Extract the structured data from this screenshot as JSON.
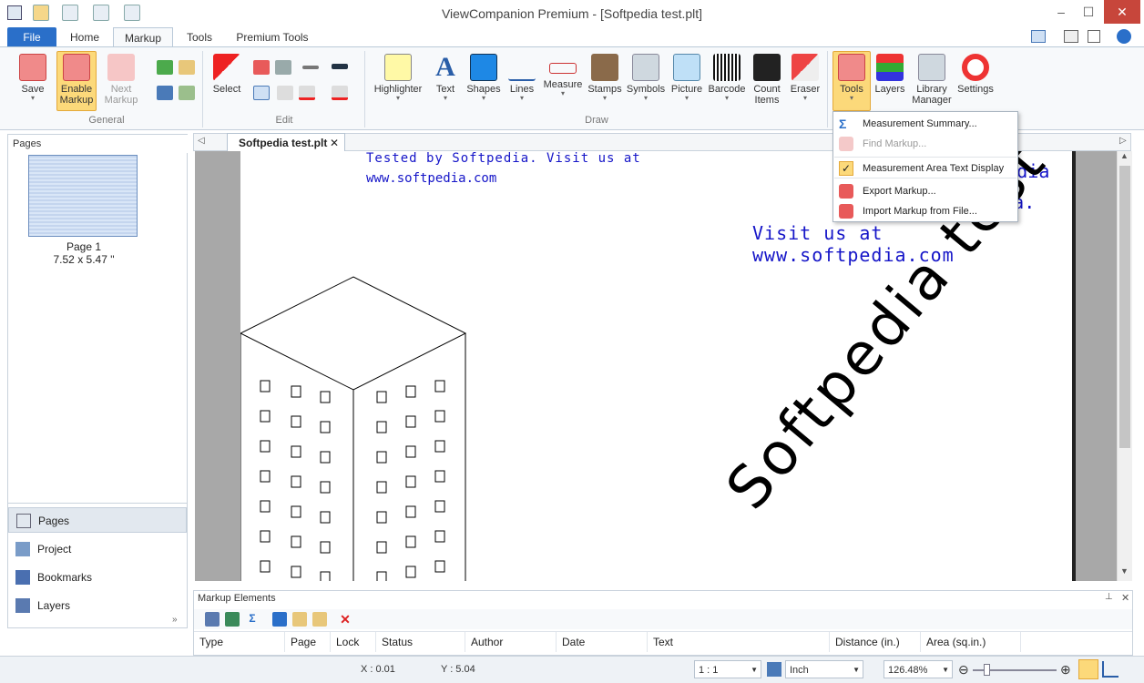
{
  "window": {
    "title": "ViewCompanion Premium - [Softpedia test.plt]",
    "minimize": "–",
    "maximize": "☐",
    "close": "✕"
  },
  "tabs": {
    "file": "File",
    "home": "Home",
    "markup": "Markup",
    "tools": "Tools",
    "premium": "Premium Tools"
  },
  "ribbon": {
    "general": {
      "label": "General",
      "save": "Save",
      "enable1": "Enable",
      "enable2": "Markup",
      "next1": "Next",
      "next2": "Markup"
    },
    "edit": {
      "label": "Edit",
      "select": "Select"
    },
    "draw": {
      "label": "Draw",
      "highlighter": "Highlighter",
      "text": "Text",
      "shapes": "Shapes",
      "lines": "Lines",
      "measure": "Measure",
      "stamps": "Stamps",
      "symbols": "Symbols",
      "picture": "Picture",
      "barcode": "Barcode",
      "count1": "Count",
      "count2": "Items",
      "eraser": "Eraser"
    },
    "right": {
      "tools": "Tools",
      "layers": "Layers",
      "library1": "Library",
      "library2": "Manager",
      "settings": "Settings"
    }
  },
  "tools_menu": {
    "items": [
      "Measurement Summary...",
      "Find Markup...",
      "Measurement  Area Text Display",
      "Export Markup...",
      "Import Markup from File..."
    ]
  },
  "left": {
    "pages_header": "Pages",
    "page_label": "Page 1",
    "page_size": "7.52 x 5.47 \"",
    "nav": [
      "Pages",
      "Project",
      "Bookmarks",
      "Layers"
    ]
  },
  "doc": {
    "tab": "Softpedia test.plt",
    "line1": "Tested  by Softpedia.   Visit   us at",
    "line2": "www.softpedia.com",
    "right1": "Softpedia",
    "right2": "pedia.",
    "right3": "Visit  us  at  www.softpedia.com",
    "diag": "Softpedia test"
  },
  "markup_panel": {
    "title": "Markup Elements",
    "columns": [
      "Type",
      "Page",
      "Lock",
      "Status",
      "Author",
      "Date",
      "Text",
      "Distance (in.)",
      "Area (sq.in.)"
    ]
  },
  "status": {
    "x": "X : 0.01",
    "y": "Y : 5.04",
    "scale": "1 : 1",
    "unit": "Inch",
    "zoom": "126.48%"
  },
  "colors": {
    "accent": "#2a6fc9",
    "drawing_text": "#1515c8",
    "highlight": "#fcd97a"
  }
}
